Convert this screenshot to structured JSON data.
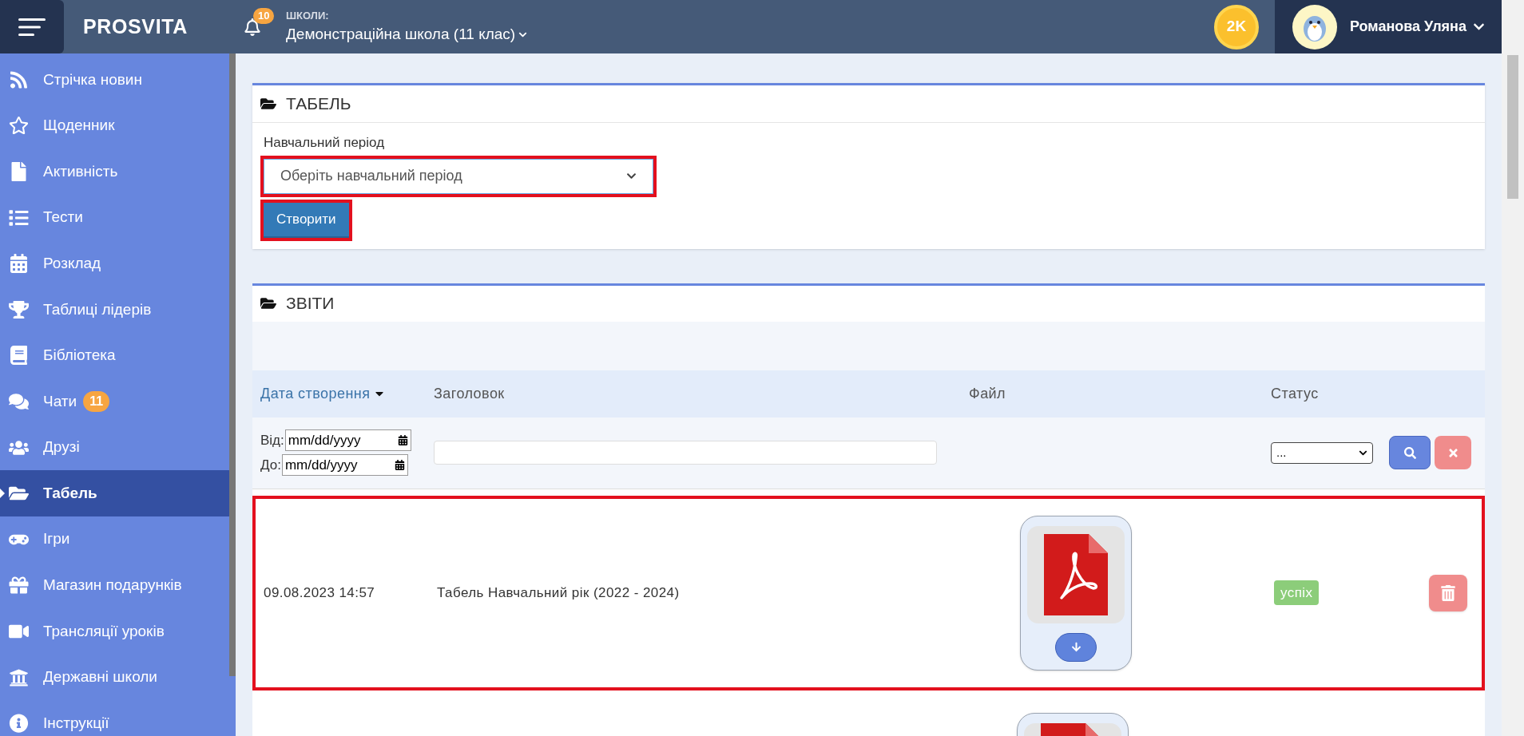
{
  "topbar": {
    "logo": "PROSVITA",
    "notifications": "10",
    "school_label": "ШКОЛИ:",
    "school": "Демонстраційна школа (11 клас)",
    "coins": "2K",
    "user": "Романова Уляна"
  },
  "sidebar": {
    "items": [
      {
        "label": "Стрічка новин",
        "selected": false
      },
      {
        "label": "Щоденник",
        "selected": false
      },
      {
        "label": "Активність",
        "selected": false
      },
      {
        "label": "Тести",
        "selected": false
      },
      {
        "label": "Розклад",
        "selected": false
      },
      {
        "label": "Таблиці лідерів",
        "selected": false
      },
      {
        "label": "Бібліотека",
        "selected": false
      },
      {
        "label": "Чати",
        "selected": false,
        "badge": "11"
      },
      {
        "label": "Друзі",
        "selected": false
      },
      {
        "label": "Табель",
        "selected": true
      },
      {
        "label": "Ігри",
        "selected": false
      },
      {
        "label": "Магазин подарунків",
        "selected": false
      },
      {
        "label": "Трансляції уроків",
        "selected": false
      },
      {
        "label": "Державні школи",
        "selected": false
      },
      {
        "label": "Інструкції",
        "selected": false
      }
    ]
  },
  "report_card": {
    "title": "ТАБЕЛЬ",
    "period_label": "Навчальний період",
    "period_select": {
      "value": "Оберіть навчальний період",
      "highlighted": true
    },
    "create_button": {
      "label": "Створити",
      "highlighted": true
    }
  },
  "reports": {
    "title": "ЗВІТИ",
    "columns": [
      {
        "label": "Дата створення",
        "sorted": true
      },
      {
        "label": "Заголовок",
        "sorted": false
      },
      {
        "label": "Файл",
        "sorted": false
      },
      {
        "label": "Статус",
        "sorted": false
      }
    ],
    "filters": {
      "from_label": "Від:",
      "from_placeholder": "mm/dd/yyyy",
      "to_label": "До:",
      "to_placeholder": "mm/dd/yyyy",
      "status_value": "..."
    },
    "rows": [
      {
        "kind": "full",
        "date": "09.08.2023 14:57",
        "title": "Табель Навчальний рік (2022 - 2024)",
        "status": "успіх",
        "highlighted": true
      },
      {
        "kind": "cut"
      }
    ]
  }
}
